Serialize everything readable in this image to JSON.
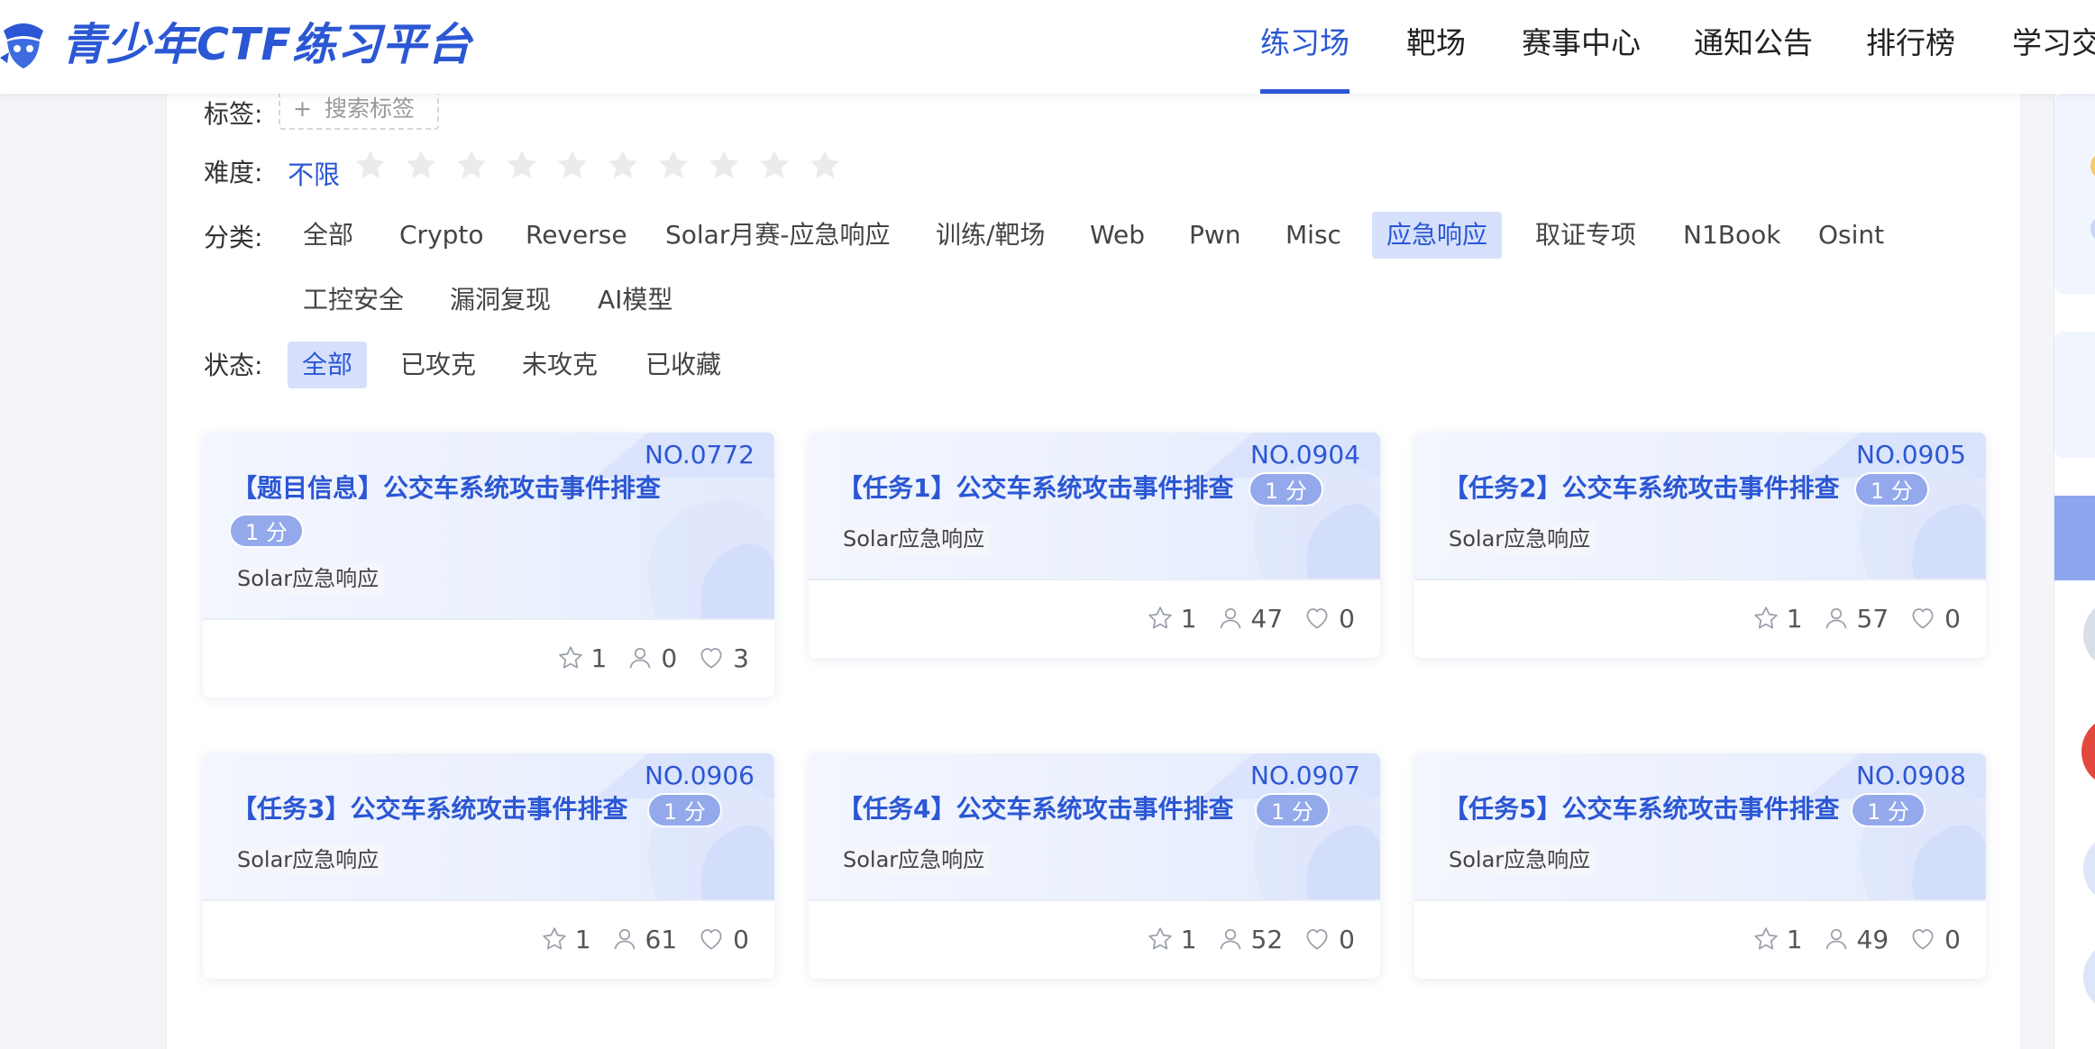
{
  "header": {
    "logo_text": "青少年CTF练习平台",
    "nav": [
      "练习场",
      "靶场",
      "赛事中心",
      "通知公告",
      "排行榜",
      "学习交"
    ]
  },
  "filters": {
    "tag_label": "标签:",
    "tag_placeholder": "搜索标签",
    "difficulty_label": "难度:",
    "difficulty_value": "不限",
    "category_label": "分类:",
    "categories": [
      "全部",
      "Crypto",
      "Reverse",
      "Solar月赛-应急响应",
      "训练/靶场",
      "Web",
      "Pwn",
      "Misc",
      "应急响应",
      "取证专项",
      "N1Book",
      "Osint",
      "工控安全",
      "漏洞复现",
      "AI模型"
    ],
    "category_selected": "应急响应",
    "status_label": "状态:",
    "statuses": [
      "全部",
      "已攻克",
      "未攻克",
      "已收藏"
    ],
    "status_selected": "全部"
  },
  "cards": [
    {
      "no": "NO.0772",
      "title": "【题目信息】公交车系统攻击事件排查",
      "score": "1 分",
      "tag": "Solar应急响应",
      "stars": "1",
      "solvers": "0",
      "likes": "3"
    },
    {
      "no": "NO.0904",
      "title": "【任务1】公交车系统攻击事件排查",
      "score": "1 分",
      "tag": "Solar应急响应",
      "stars": "1",
      "solvers": "47",
      "likes": "0"
    },
    {
      "no": "NO.0905",
      "title": "【任务2】公交车系统攻击事件排查",
      "score": "1 分",
      "tag": "Solar应急响应",
      "stars": "1",
      "solvers": "57",
      "likes": "0"
    },
    {
      "no": "NO.0906",
      "title": "【任务3】公交车系统攻击事件排查",
      "score": "1 分",
      "tag": "Solar应急响应",
      "stars": "1",
      "solvers": "61",
      "likes": "0"
    },
    {
      "no": "NO.0907",
      "title": "【任务4】公交车系统攻击事件排查",
      "score": "1 分",
      "tag": "Solar应急响应",
      "stars": "1",
      "solvers": "52",
      "likes": "0"
    },
    {
      "no": "NO.0908",
      "title": "【任务5】公交车系统攻击事件排查",
      "score": "1 分",
      "tag": "Solar应急响应",
      "stars": "1",
      "solvers": "49",
      "likes": "0"
    }
  ],
  "colors": {
    "accent": "#2b57d4",
    "score_badge": "#93a9ec",
    "selected_bg": "#d6e0fb"
  }
}
